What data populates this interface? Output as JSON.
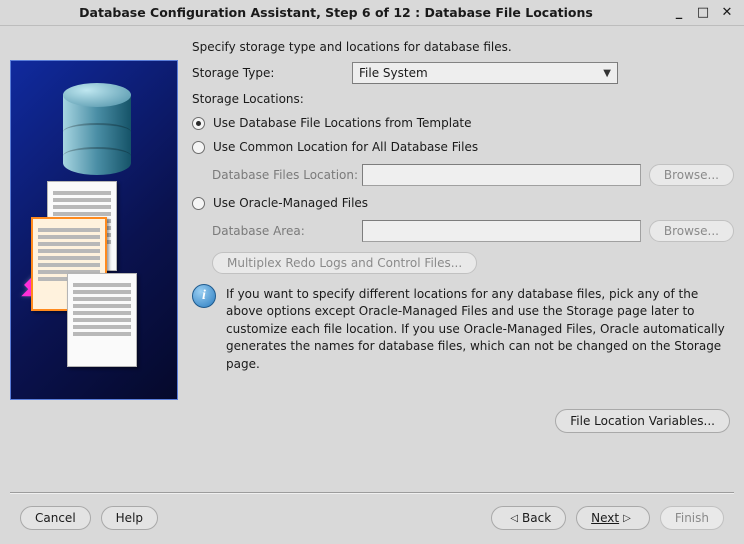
{
  "window": {
    "title": "Database Configuration Assistant, Step 6 of 12 : Database File Locations"
  },
  "instructions": "Specify storage type and locations for database files.",
  "storageType": {
    "label": "Storage Type:",
    "value": "File System"
  },
  "storageLocations": {
    "label": "Storage Locations:",
    "opt1": "Use Database File Locations from Template",
    "opt2": "Use Common Location for All Database Files",
    "opt2_field_label": "Database Files Location:",
    "opt3": "Use Oracle-Managed Files",
    "opt3_field_label": "Database Area:"
  },
  "buttons": {
    "browse": "Browse...",
    "multiplex": "Multiplex Redo Logs and Control Files...",
    "fileLocationVariables": "File Location Variables...",
    "cancel": "Cancel",
    "help": "Help",
    "back": "Back",
    "next": "Next",
    "finish": "Finish"
  },
  "info": "If you want to specify different locations for any database files, pick any of the above options except Oracle-Managed Files and use the Storage page later to customize each file location. If you use Oracle-Managed Files, Oracle automatically generates the names for database files, which can not be changed on the Storage page."
}
